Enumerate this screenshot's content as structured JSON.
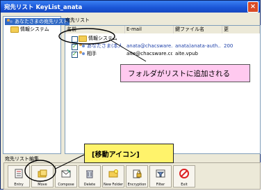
{
  "window": {
    "title": "宛先リスト KeyList_anata"
  },
  "tree": {
    "items": [
      {
        "label": "あなたさまの宛先リスト",
        "selected": true
      },
      {
        "label": "情報システム",
        "selected": false
      }
    ]
  },
  "list": {
    "caption": "宛先リスト",
    "columns": [
      "名前",
      "E-mail",
      "鍵ファイル名",
      "更"
    ],
    "rows": [
      {
        "checked": false,
        "name": "情報システム",
        "email": "",
        "keyfile": "",
        "updated": ""
      },
      {
        "checked": true,
        "name": "あなたさま(本人)",
        "email": "anata@chacsware....",
        "keyfile": "anata)anata-auth....",
        "updated": "200"
      },
      {
        "checked": true,
        "name": "相手",
        "email": "aite@chacsware.com",
        "keyfile": "aite.vpub",
        "updated": ""
      }
    ]
  },
  "callout": {
    "text": "フォルダがリストに追加される"
  },
  "annotation": {
    "text": "[移動アイコン]"
  },
  "toolbar": {
    "label": "宛先リスト編集",
    "tools": [
      {
        "label": "Entry",
        "icon": "entry-icon"
      },
      {
        "label": "Move",
        "icon": "move-folder-icon"
      },
      {
        "label": "Compose",
        "icon": "compose-icon"
      },
      {
        "label": "Delete",
        "icon": "delete-icon"
      },
      {
        "label": "New Folder",
        "icon": "new-folder-icon"
      },
      {
        "label": "Encryption",
        "icon": "encryption-icon"
      },
      {
        "label": "Filter",
        "icon": "filter-icon"
      },
      {
        "label": "Exit",
        "icon": "exit-icon"
      }
    ]
  },
  "colors": {
    "titlebar": "#1a55d6",
    "callout": "#ffc9ef",
    "annotation": "#fff36b",
    "selection": "#316ac5"
  }
}
